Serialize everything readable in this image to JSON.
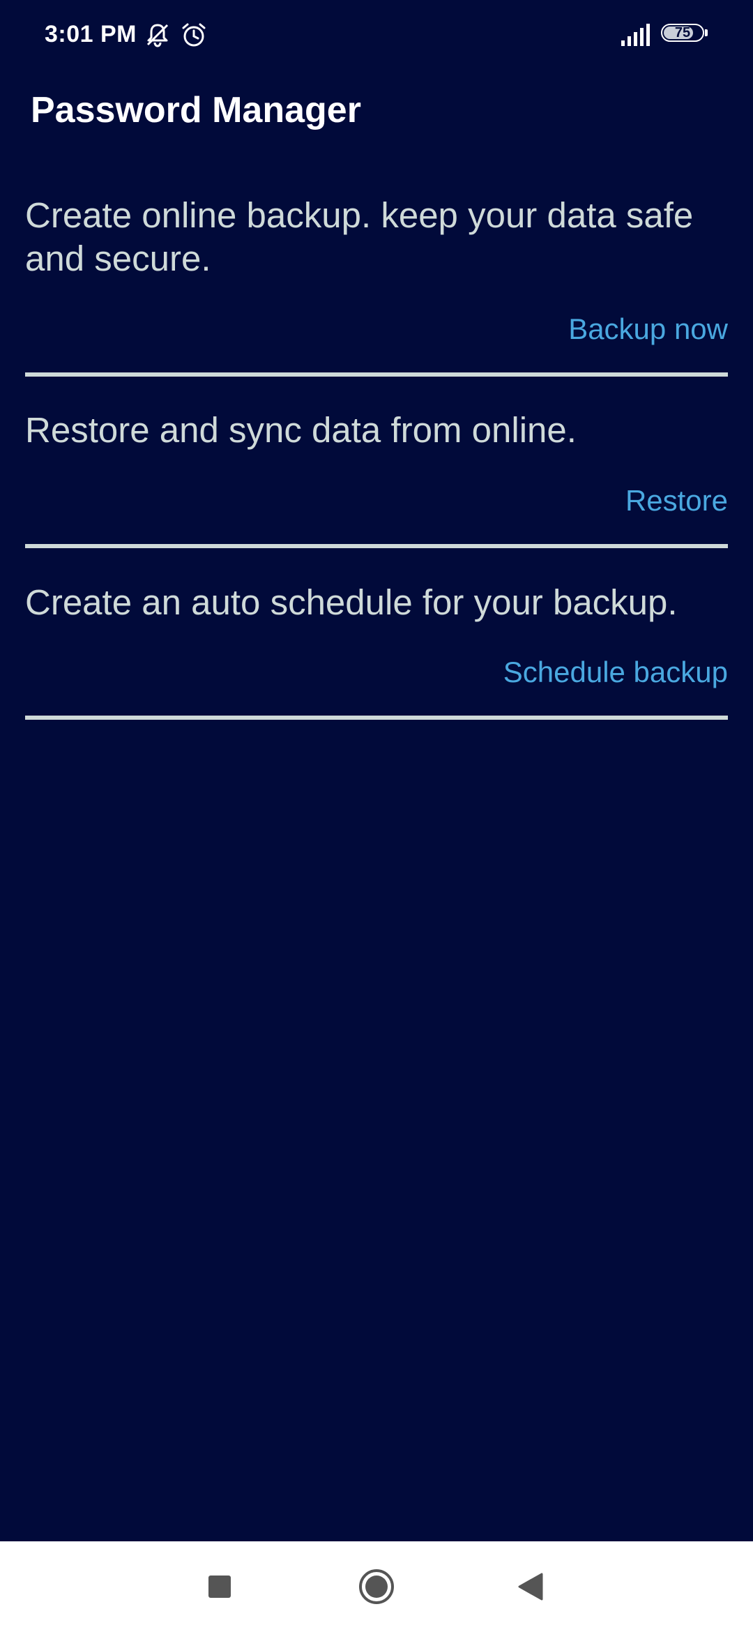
{
  "status_bar": {
    "time": "3:01 PM",
    "battery_level": "75",
    "icons": [
      "silent-icon",
      "alarm-icon",
      "signal-icon",
      "battery-icon"
    ]
  },
  "app": {
    "title": "Password Manager"
  },
  "sections": [
    {
      "description": "Create online backup. keep your data safe and secure.",
      "action_label": "Backup now"
    },
    {
      "description": "Restore and sync data from online.",
      "action_label": "Restore"
    },
    {
      "description": "Create an auto schedule for your backup.",
      "action_label": "Schedule backup"
    }
  ],
  "nav_bar": {
    "icons": [
      "recents-icon",
      "home-icon",
      "back-icon"
    ]
  },
  "colors": {
    "background": "#010a3a",
    "text": "#cfdad9",
    "accent": "#4aa8e0",
    "title": "#ffffff",
    "nav_background": "#ffffff",
    "nav_icons": "#555555"
  }
}
